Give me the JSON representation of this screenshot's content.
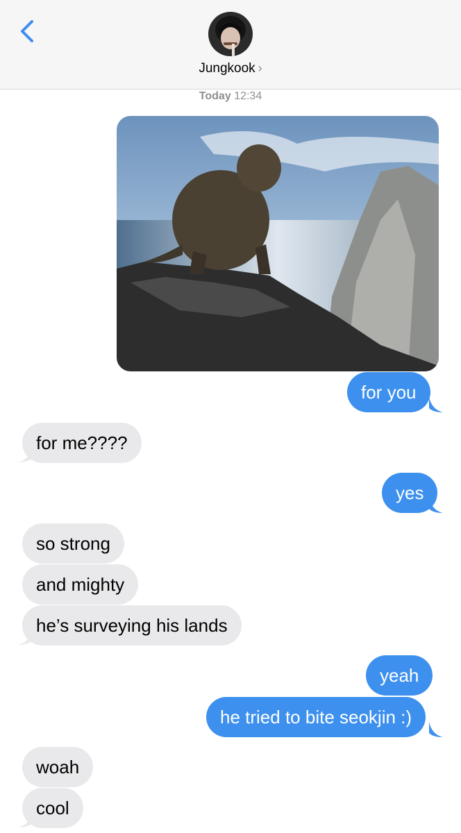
{
  "header": {
    "contact_name": "Jungkook",
    "contact_chevron": "›",
    "back_icon": "chevron-left-icon"
  },
  "timestamp": {
    "day": "Today",
    "time": "12:34"
  },
  "colors": {
    "accent": "#3d90ee",
    "incoming": "#e9e9eb",
    "header_bg": "#f6f6f6"
  },
  "messages": [
    {
      "direction": "out",
      "type": "image",
      "description_icon": "monkey-photo"
    },
    {
      "direction": "out",
      "text": "for you"
    },
    {
      "direction": "in",
      "text": "for me????"
    },
    {
      "direction": "out",
      "text": "yes"
    },
    {
      "direction": "in",
      "text": "so strong"
    },
    {
      "direction": "in",
      "text": "and mighty"
    },
    {
      "direction": "in",
      "text": "he’s surveying his lands"
    },
    {
      "direction": "out",
      "text": "yeah"
    },
    {
      "direction": "out",
      "text": "he tried to bite seokjin :)"
    },
    {
      "direction": "in",
      "text": "woah"
    },
    {
      "direction": "in",
      "text": "cool"
    }
  ]
}
